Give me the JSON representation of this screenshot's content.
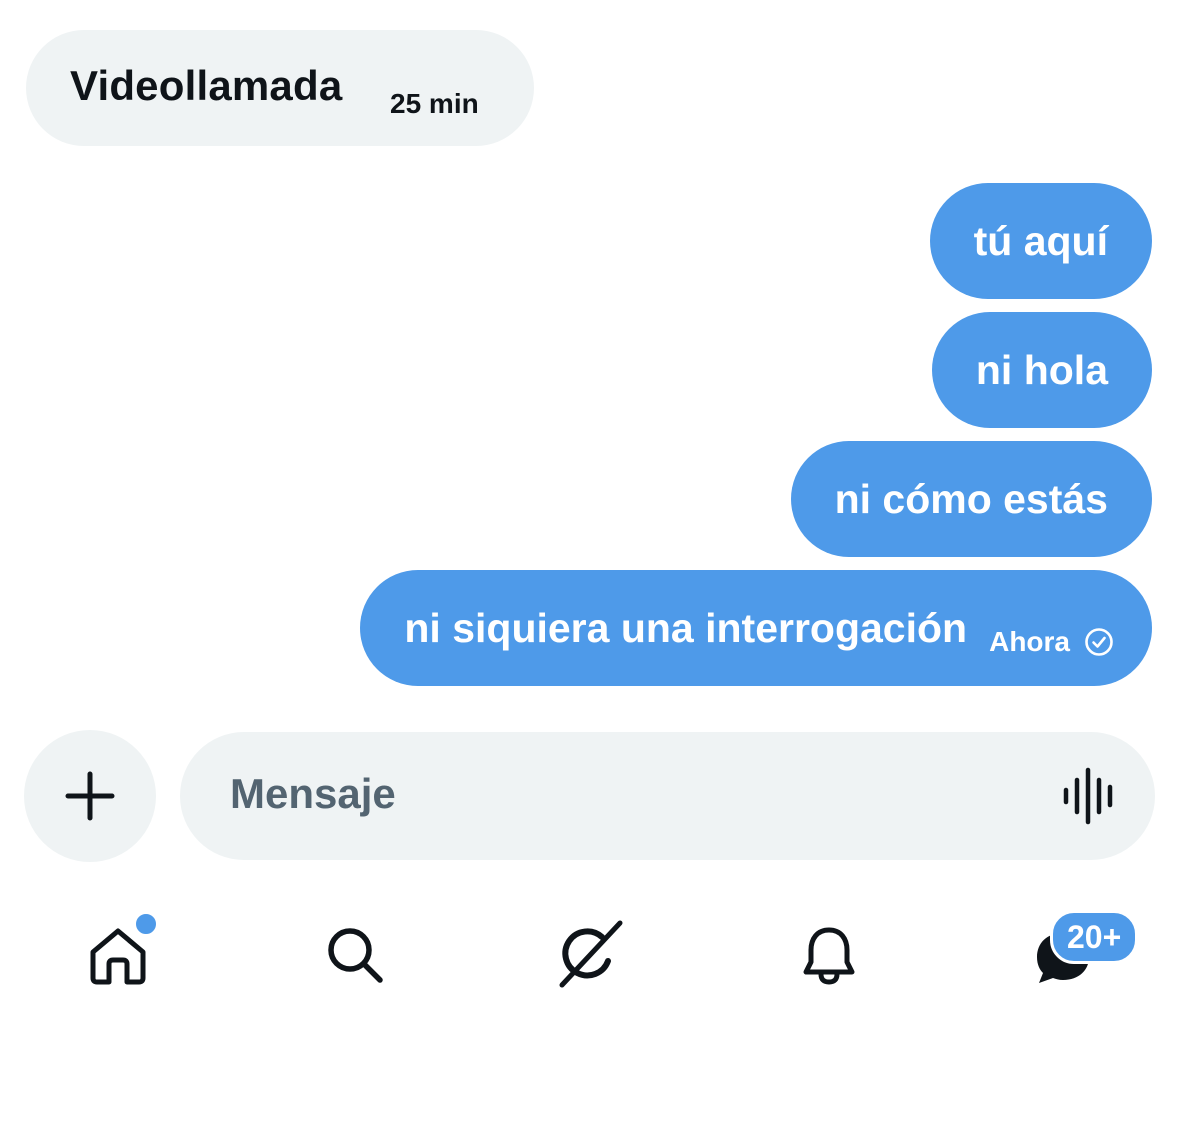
{
  "call": {
    "title": "Videollamada",
    "duration": "25 min"
  },
  "messages": [
    {
      "text": "tú aquí"
    },
    {
      "text": "ni hola"
    },
    {
      "text": "ni cómo estás"
    },
    {
      "text": "ni siquiera una interrogación",
      "time": "Ahora",
      "status_icon": "check-circle-icon"
    }
  ],
  "composer": {
    "add_icon": "plus-icon",
    "placeholder": "Mensaje",
    "voice_icon": "waveform-icon"
  },
  "nav": {
    "items": [
      {
        "icon": "home-icon",
        "has_dot": true
      },
      {
        "icon": "search-icon"
      },
      {
        "icon": "grok-icon"
      },
      {
        "icon": "bell-icon"
      },
      {
        "icon": "chat-bubble-icon"
      }
    ],
    "messages_badge": "20+"
  },
  "colors": {
    "bubble_sent": "#4e9ae9",
    "bubble_neutral": "#eff3f4",
    "text_primary": "#0f1419",
    "placeholder": "#536471",
    "badge": "#4e9ae9"
  }
}
